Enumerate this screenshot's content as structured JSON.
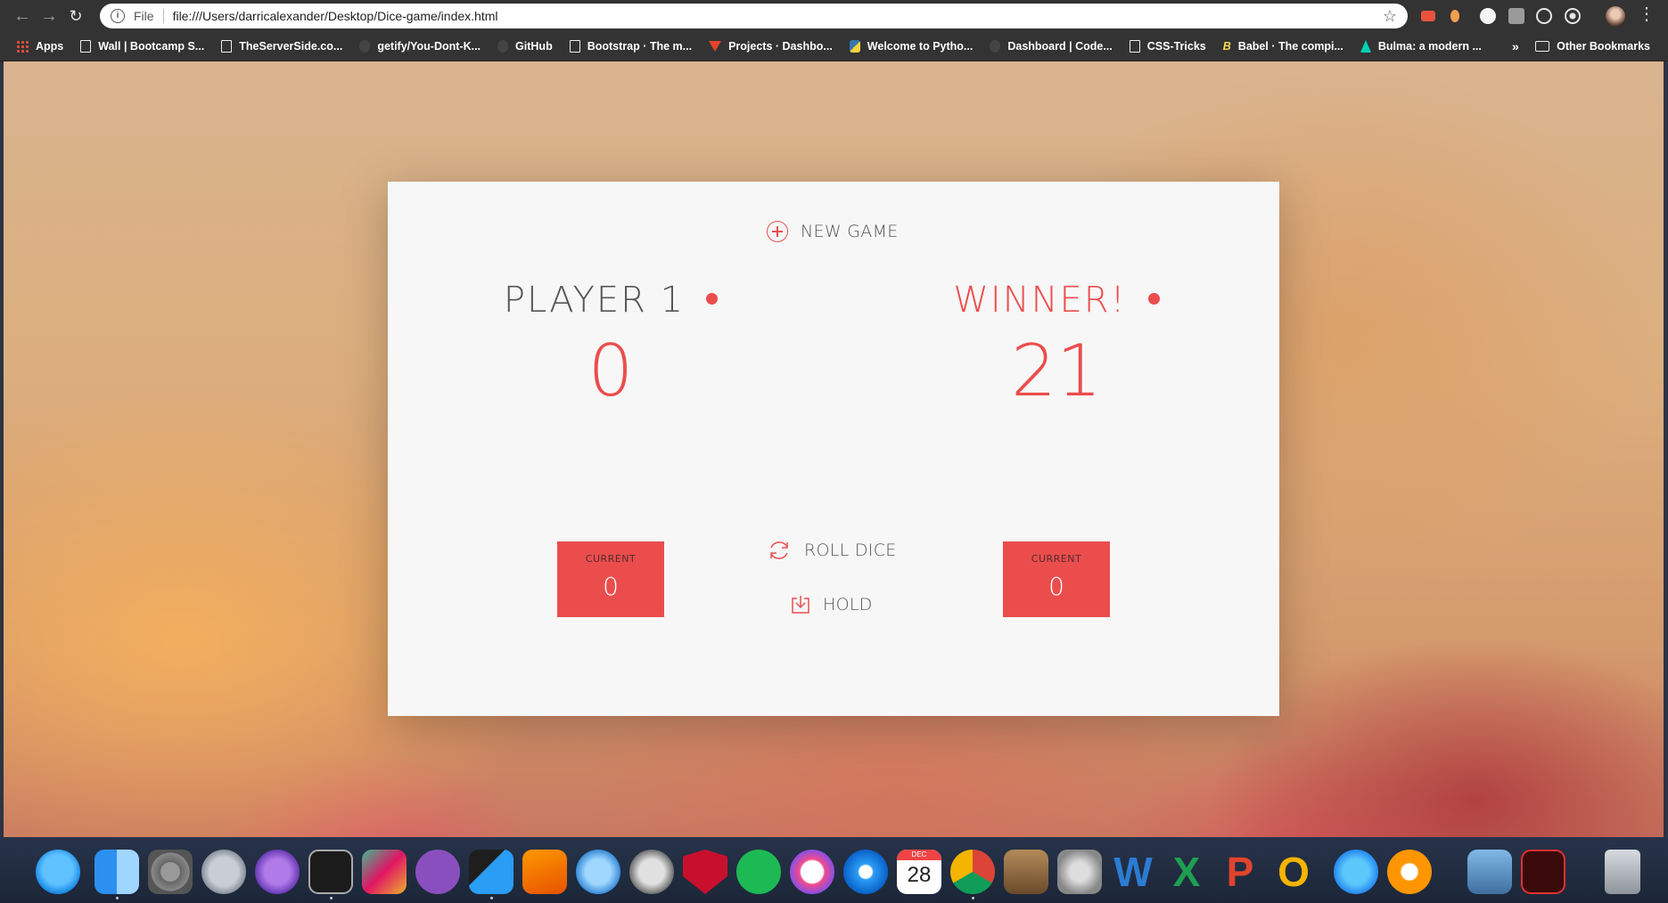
{
  "browser": {
    "scheme_label": "File",
    "url": "file:///Users/darricalexander/Desktop/Dice-game/index.html"
  },
  "bookmarks": [
    {
      "label": "Apps"
    },
    {
      "label": "Wall | Bootcamp S..."
    },
    {
      "label": "TheServerSide.co..."
    },
    {
      "label": "getify/You-Dont-K..."
    },
    {
      "label": "GitHub"
    },
    {
      "label": "Bootstrap · The m..."
    },
    {
      "label": "Projects · Dashbo..."
    },
    {
      "label": "Welcome to Pytho..."
    },
    {
      "label": "Dashboard | Code..."
    },
    {
      "label": "CSS-Tricks"
    },
    {
      "label": "Babel · The compi..."
    },
    {
      "label": "Bulma: a modern ..."
    }
  ],
  "bookmarks_overflow": "»",
  "other_bookmarks": "Other Bookmarks",
  "game": {
    "new_game": "NEW GAME",
    "player1": {
      "name": "PLAYER 1",
      "score": "0",
      "current_label": "CURRENT",
      "current": "0"
    },
    "player2": {
      "name": "WINNER!",
      "score": "21",
      "current_label": "CURRENT",
      "current": "0"
    },
    "roll_dice": "ROLL DICE",
    "hold": "HOLD"
  },
  "dock": {
    "calendar_month": "DEC",
    "calendar_day": "28",
    "icons": [
      "messages-icon",
      "finder-icon",
      "system-preferences-icon",
      "launchpad-icon",
      "imovie-icon",
      "terminal-icon",
      "slack-icon",
      "github-desktop-icon",
      "vscode-icon",
      "sublime-text-icon",
      "sequel-pro-icon",
      "tableplus-icon",
      "mcafee-icon",
      "spotify-icon",
      "itunes-icon",
      "safari-icon",
      "calendar-icon",
      "chrome-icon",
      "garageband-icon",
      "disk-utility-icon",
      "word-icon",
      "excel-icon",
      "powerpoint-icon",
      "outlook-icon",
      "app-store-icon",
      "books-icon",
      "preview-icon",
      "acrobat-icon",
      "trash-icon"
    ]
  },
  "colors": {
    "accent": "#eb4d4d",
    "panel": "#f7f7f7",
    "chrome": "#333333"
  }
}
